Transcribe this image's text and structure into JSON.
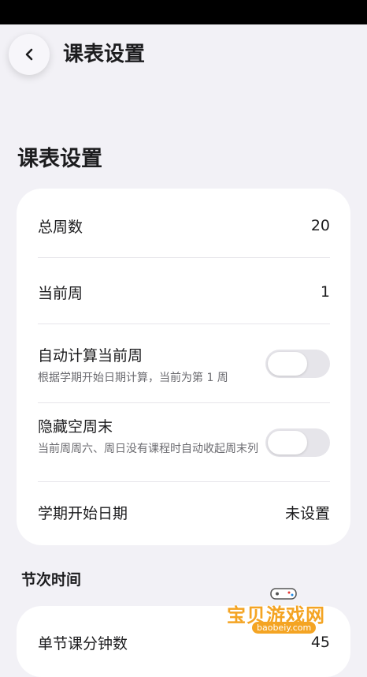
{
  "header": {
    "title": "课表设置"
  },
  "section": {
    "title": "课表设置"
  },
  "rows": {
    "total_weeks": {
      "label": "总周数",
      "value": "20"
    },
    "current_week": {
      "label": "当前周",
      "value": "1"
    },
    "auto_calc": {
      "label": "自动计算当前周",
      "desc": "根据学期开始日期计算，当前为第 1 周",
      "enabled": false
    },
    "hide_weekend": {
      "label": "隐藏空周末",
      "desc": "当前周周六、周日没有课程时自动收起周末列",
      "enabled": false
    },
    "term_start": {
      "label": "学期开始日期",
      "value": "未设置"
    }
  },
  "time_section": {
    "title": "节次时间",
    "lesson_minutes": {
      "label": "单节课分钟数",
      "value": "45"
    }
  },
  "watermark": {
    "text": "宝贝游戏网",
    "url": "baobeiy.com"
  },
  "icons": {
    "back": "chevron-left-icon"
  },
  "colors": {
    "background": "#f2f1f6",
    "card": "#ffffff",
    "toggle_off": "#e6e5ea",
    "watermark": "#f4a423"
  }
}
